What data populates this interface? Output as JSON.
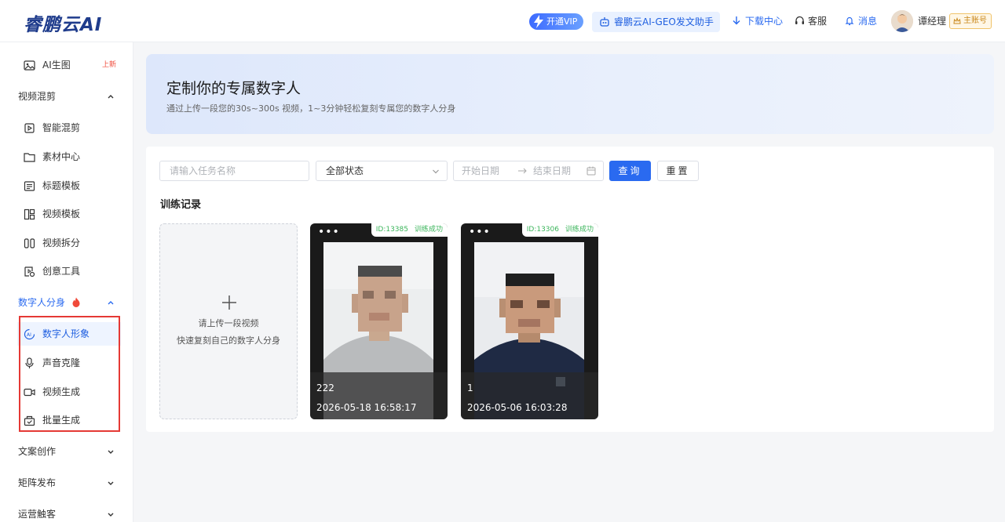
{
  "header": {
    "logo": "睿鹏云AI",
    "vip_label": "开通VIP",
    "geo_label": "睿鹏云AI-GEO发文助手",
    "download_label": "下载中心",
    "service_label": "客服",
    "message_label": "消息",
    "user_name": "谭经理",
    "account_badge": "主账号"
  },
  "sidebar": {
    "ai_image": "AI生图",
    "ai_image_badge": "上新",
    "group_video_mix": "视频混剪",
    "smart_mix": "智能混剪",
    "material_center": "素材中心",
    "title_template": "标题模板",
    "video_template": "视频模板",
    "video_split": "视频拆分",
    "creative_tools": "创意工具",
    "group_digital_human": "数字人分身",
    "digital_human_image": "数字人形象",
    "voice_clone": "声音克隆",
    "video_generate": "视频生成",
    "batch_generate": "批量生成",
    "group_copywriting": "文案创作",
    "group_matrix_publish": "矩阵发布",
    "group_operations": "运营触客"
  },
  "banner": {
    "title": "定制你的专属数字人",
    "subtitle": "通过上传一段您的30s~300s 视频，1~3分钟轻松复刻专属您的数字人分身"
  },
  "filters": {
    "task_name_placeholder": "请输入任务名称",
    "status_selected": "全部状态",
    "start_date_placeholder": "开始日期",
    "end_date_placeholder": "结束日期",
    "query_button": "查询",
    "reset_button": "重置"
  },
  "records": {
    "title": "训练记录",
    "upload_line1": "请上传一段视频",
    "upload_line2": "快速复刻自己的数字人分身",
    "items": [
      {
        "id_label": "ID:13385",
        "status": "训练成功",
        "name": "222",
        "time": "2026-05-18 16:58:17"
      },
      {
        "id_label": "ID:13306",
        "status": "训练成功",
        "name": "1",
        "time": "2026-05-06 16:03:28"
      }
    ]
  },
  "colors": {
    "primary": "#2a6af0",
    "success": "#3bb55b",
    "highlight_border": "#e53935"
  }
}
